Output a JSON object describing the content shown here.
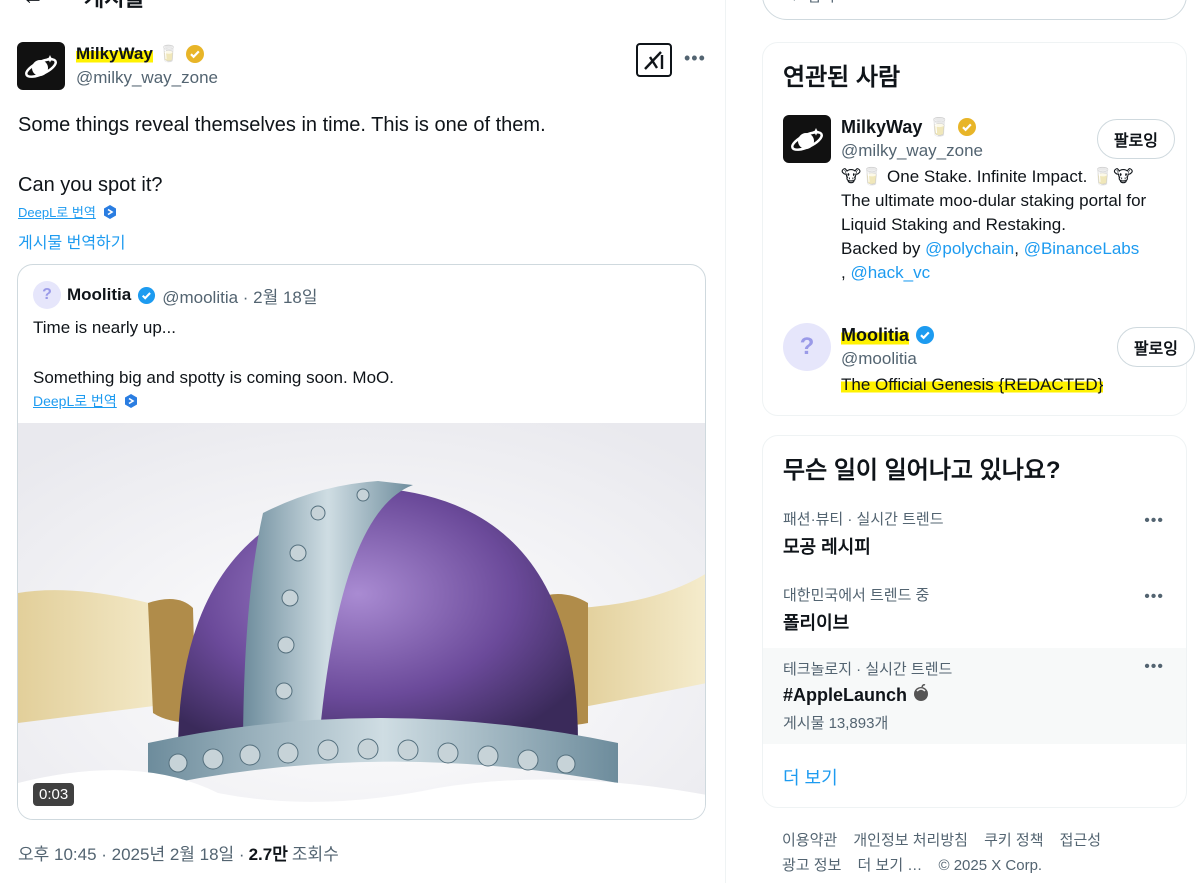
{
  "header": {
    "back_icon": "arrow-left-icon",
    "title": "게시물"
  },
  "tweet": {
    "author_name": "MilkyWay",
    "author_emoji": "🥛",
    "author_handle": "@milky_way_zone",
    "text_line1": "Some things reveal themselves in time. This is one of them.",
    "text_line2": "Can you spot it?",
    "deepl_label": "DeepL로 번역",
    "translate_label": "게시물 번역하기",
    "timestamp": "오후 10:45 · 2025년 2월 18일 ·",
    "views_count": "2.7만",
    "views_label": "조회수"
  },
  "quote": {
    "name": "Moolitia",
    "handle_date": "@moolitia · 2월 18일",
    "avatar_glyph": "?",
    "text_line1": "Time is nearly up...",
    "text_line2": "Something big and spotty is coming soon. MoO.",
    "deepl_label": "DeepL로 번역",
    "video_time": "0:03"
  },
  "search": {
    "placeholder": "검색"
  },
  "related": {
    "title": "연관된 사람",
    "people": [
      {
        "name": "MilkyWay",
        "emoji": "🥛",
        "handle": "@milky_way_zone",
        "follow_label": "팔로잉",
        "bio_line1": "🐮🥛 One Stake. Infinite Impact. 🥛🐮",
        "bio_line2": "The ultimate moo-dular staking portal for Liquid Staking and Restaking.",
        "bio_backed": "Backed by",
        "mention1": "@polychain",
        "sep1": ",",
        "mention2": "@BinanceLabs",
        "sep2": ",",
        "mention3": "@hack_vc"
      },
      {
        "name": "Moolitia",
        "handle": "@moolitia",
        "follow_label": "팔로잉",
        "bio": "The Official Genesis {REDACTED}"
      }
    ]
  },
  "trends": {
    "title": "무슨 일이 일어나고 있나요?",
    "items": [
      {
        "category": "패션·뷰티 · 실시간 트렌드",
        "title": "모공 레시피",
        "count": ""
      },
      {
        "category": "대한민국에서 트렌드 중",
        "title": "폴리이브",
        "count": ""
      },
      {
        "category": "테크놀로지 · 실시간 트렌드",
        "title": "#AppleLaunch",
        "count": "게시물 13,893개"
      }
    ],
    "show_more": "더 보기"
  },
  "footer": {
    "links": [
      "이용약관",
      "개인정보 처리방침",
      "쿠키 정책",
      "접근성",
      "광고 정보",
      "더 보기 …"
    ],
    "copyright": "© 2025 X Corp."
  },
  "colors": {
    "accent": "#1d9bf0",
    "highlight": "#fff200",
    "gold_badge": "#e8b528",
    "blue_badge": "#1d9bf0"
  }
}
